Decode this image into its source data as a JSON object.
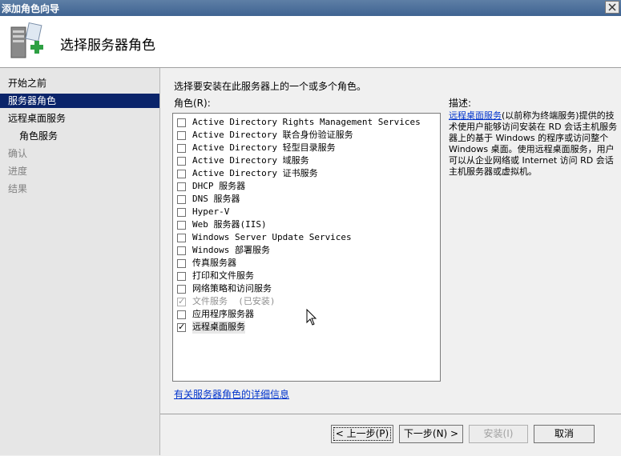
{
  "window": {
    "title": "添加角色向导"
  },
  "header": {
    "title": "选择服务器角色"
  },
  "nav": {
    "items": [
      {
        "label": "开始之前"
      },
      {
        "label": "服务器角色"
      },
      {
        "label": "远程桌面服务"
      },
      {
        "label": "角色服务"
      },
      {
        "label": "确认"
      },
      {
        "label": "进度"
      },
      {
        "label": "结果"
      }
    ]
  },
  "main": {
    "instruction": "选择要安装在此服务器上的一个或多个角色。",
    "roles_label": "角色(R):",
    "roles": [
      {
        "label": "Active Directory Rights Management Services",
        "checked": false,
        "disabled": false
      },
      {
        "label": "Active Directory 联合身份验证服务",
        "checked": false,
        "disabled": false
      },
      {
        "label": "Active Directory 轻型目录服务",
        "checked": false,
        "disabled": false
      },
      {
        "label": "Active Directory 域服务",
        "checked": false,
        "disabled": false
      },
      {
        "label": "Active Directory 证书服务",
        "checked": false,
        "disabled": false
      },
      {
        "label": "DHCP 服务器",
        "checked": false,
        "disabled": false
      },
      {
        "label": "DNS 服务器",
        "checked": false,
        "disabled": false
      },
      {
        "label": "Hyper-V",
        "checked": false,
        "disabled": false
      },
      {
        "label": "Web 服务器(IIS)",
        "checked": false,
        "disabled": false
      },
      {
        "label": "Windows Server Update Services",
        "checked": false,
        "disabled": false
      },
      {
        "label": "Windows 部署服务",
        "checked": false,
        "disabled": false
      },
      {
        "label": "传真服务器",
        "checked": false,
        "disabled": false
      },
      {
        "label": "打印和文件服务",
        "checked": false,
        "disabled": false
      },
      {
        "label": "网络策略和访问服务",
        "checked": false,
        "disabled": false
      },
      {
        "label": "文件服务  (已安装)",
        "checked": true,
        "disabled": true
      },
      {
        "label": "应用程序服务器",
        "checked": false,
        "disabled": false
      },
      {
        "label": "远程桌面服务",
        "checked": true,
        "disabled": false
      }
    ],
    "description_label": "描述:",
    "description_link": "远程桌面服务",
    "description_text": "(以前称为终端服务)提供的技术使用户能够访问安装在 RD 会话主机服务器上的基于 Windows 的程序或访问整个 Windows 桌面。使用远程桌面服务，用户可以从企业网络或 Internet 访问 RD 会话主机服务器或虚拟机。",
    "more_info_link": "有关服务器角色的详细信息"
  },
  "footer": {
    "back": "< 上一步(P)",
    "next": "下一步(N) >",
    "install": "安装(I)",
    "cancel": "取消"
  },
  "colors": {
    "nav_active": "#0a246a",
    "link": "#0033cc"
  }
}
